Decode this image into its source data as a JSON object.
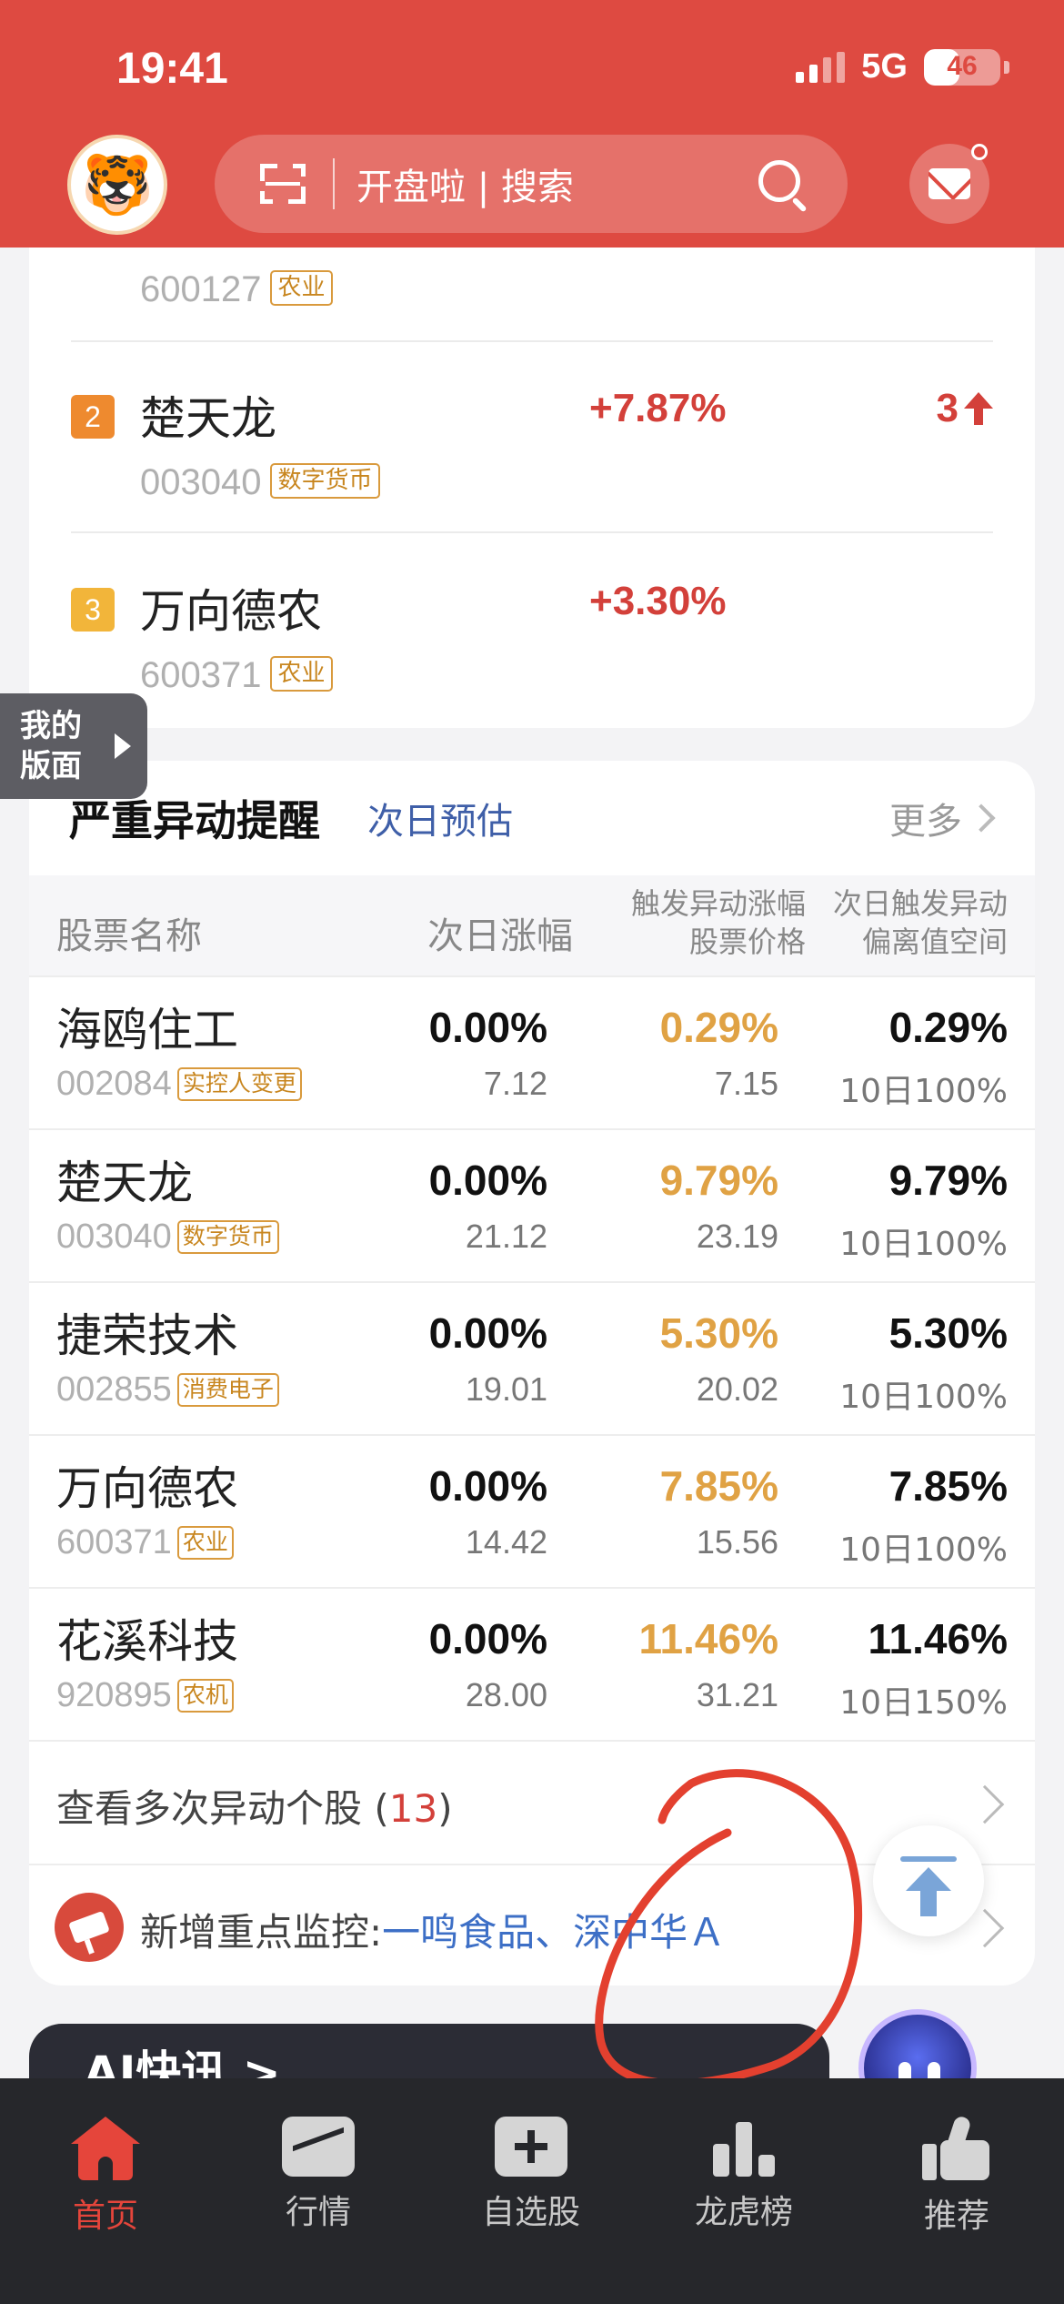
{
  "status_bar": {
    "time": "19:41",
    "network": "5G",
    "battery": "46",
    "battery_level": 0.46
  },
  "header": {
    "search_placeholder": "开盘啦 | 搜索",
    "avatar_emoji": "🐯",
    "colors": {
      "brand": "#de4a41"
    }
  },
  "top_list": {
    "partial_item": {
      "code": "600127",
      "tag": "农业"
    },
    "items": [
      {
        "rank": "2",
        "name": "楚天龙",
        "code": "003040",
        "tag": "数字货币",
        "change": "+7.87%",
        "count": "3",
        "rank_color": "#ee8a2f"
      },
      {
        "rank": "3",
        "name": "万向德农",
        "code": "600371",
        "tag": "农业",
        "change": "+3.30%",
        "count": "",
        "rank_color": "#f2b53a"
      }
    ]
  },
  "my_page_tab": {
    "label": "我的版面"
  },
  "anomaly": {
    "title": "严重异动提醒",
    "subtitle": "次日预估",
    "more": "更多",
    "columns": {
      "name": "股票名称",
      "next_change": "次日涨幅",
      "trigger_line1": "触发异动涨幅",
      "trigger_line2": "股票价格",
      "deviation_line1": "次日触发异动",
      "deviation_line2": "偏离值空间"
    },
    "rows": [
      {
        "name": "海鸥住工",
        "code": "002084",
        "tag": "实控人变更",
        "next_change": "0.00%",
        "price": "7.12",
        "trigger_change": "0.29%",
        "trigger_price": "7.15",
        "deviation": "0.29%",
        "window": "10日100%"
      },
      {
        "name": "楚天龙",
        "code": "003040",
        "tag": "数字货币",
        "next_change": "0.00%",
        "price": "21.12",
        "trigger_change": "9.79%",
        "trigger_price": "23.19",
        "deviation": "9.79%",
        "window": "10日100%"
      },
      {
        "name": "捷荣技术",
        "code": "002855",
        "tag": "消费电子",
        "next_change": "0.00%",
        "price": "19.01",
        "trigger_change": "5.30%",
        "trigger_price": "20.02",
        "deviation": "5.30%",
        "window": "10日100%"
      },
      {
        "name": "万向德农",
        "code": "600371",
        "tag": "农业",
        "next_change": "0.00%",
        "price": "14.42",
        "trigger_change": "7.85%",
        "trigger_price": "15.56",
        "deviation": "7.85%",
        "window": "10日100%"
      },
      {
        "name": "花溪科技",
        "code": "920895",
        "tag": "农机",
        "next_change": "0.00%",
        "price": "28.00",
        "trigger_change": "11.46%",
        "trigger_price": "31.21",
        "deviation": "11.46%",
        "window": "10日150%"
      }
    ],
    "multi_link": {
      "label": "查看多次异动个股",
      "count": "13"
    },
    "monitor": {
      "label": "新增重点监控:",
      "stocks": "一鸣食品、深中华Ａ"
    }
  },
  "ai_section": {
    "title": "AI快讯 >"
  },
  "bottom_nav": [
    {
      "label": "首页",
      "icon": "home-icon",
      "active": true
    },
    {
      "label": "行情",
      "icon": "trend-icon",
      "active": false
    },
    {
      "label": "自选股",
      "icon": "plus-box-icon",
      "active": false
    },
    {
      "label": "龙虎榜",
      "icon": "bar-chart-icon",
      "active": false
    },
    {
      "label": "推荐",
      "icon": "thumbs-up-icon",
      "active": false
    }
  ]
}
